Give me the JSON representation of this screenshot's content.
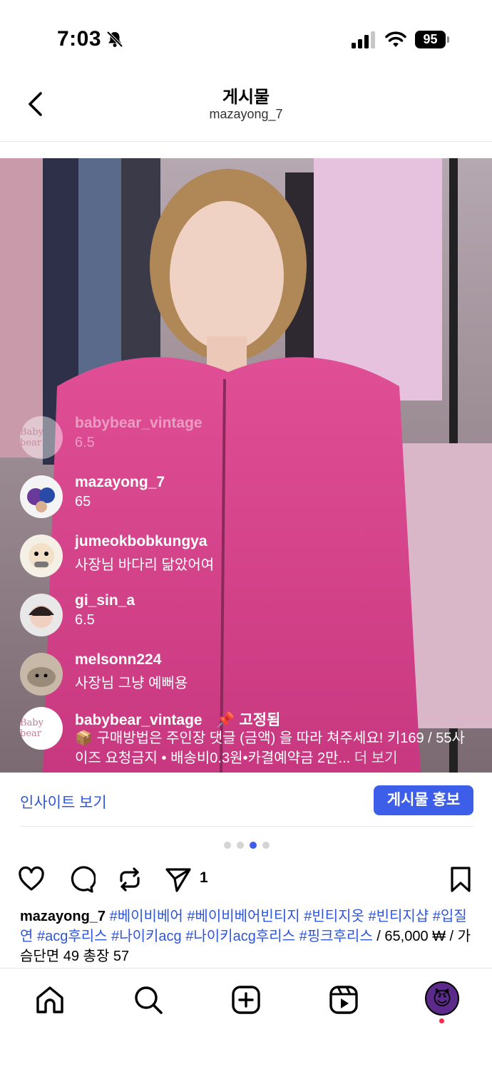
{
  "status_bar": {
    "time": "7:03",
    "battery": "95"
  },
  "header": {
    "title": "게시물",
    "subtitle": "mazayong_7"
  },
  "media": {
    "comments": [
      {
        "username": "babybear_vintage",
        "text": "6.5",
        "avatar": "Baby bear"
      },
      {
        "username": "mazayong_7",
        "text": "65",
        "avatar": ""
      },
      {
        "username": "jumeokbobkungya",
        "text": "사장님 바다리 닮았어여",
        "avatar": ""
      },
      {
        "username": "gi_sin_a",
        "text": "6.5",
        "avatar": ""
      },
      {
        "username": "melsonn224",
        "text": "사장님 그냥 예뻐용",
        "avatar": ""
      }
    ],
    "pinned": {
      "username": "babybear_vintage",
      "badge": "고정됨",
      "avatar": "Baby bear",
      "text": "📦 구매방법은 주인장 댓글 (금액) 을 따라 쳐주세요! 키169 / 55사이즈 요청금지 • 배송비0.3원•카결예약금 2만...",
      "more": "더 보기"
    }
  },
  "insight": {
    "link": "인사이트 보기",
    "promote": "게시물 홍보"
  },
  "carousel": {
    "count": 4,
    "active": 2
  },
  "actions": {
    "share_count": "1"
  },
  "caption": {
    "username": "mazayong_7",
    "tags": [
      "#베이비베어",
      "#베이비베어빈티지",
      "#빈티지옷",
      "#빈티지샵",
      "#입질연",
      "#acg후리스",
      "#나이키acg",
      "#나이키acg후리스",
      "#핑크후리스"
    ],
    "text": "/ 65,000 ₩ / 가슴단면 49 총장 57"
  },
  "icons": {
    "back": "chevron-left-icon",
    "like": "heart-icon",
    "comment": "comment-bubble-icon",
    "repost": "repost-icon",
    "share": "send-icon",
    "save": "bookmark-icon",
    "home": "home-icon",
    "search": "search-icon",
    "create": "plus-square-icon",
    "reels": "reels-icon",
    "profile": "profile-avatar"
  },
  "colors": {
    "accent": "#3d5ee8",
    "link": "#2f56d8",
    "notification": "#ff2a4a"
  }
}
